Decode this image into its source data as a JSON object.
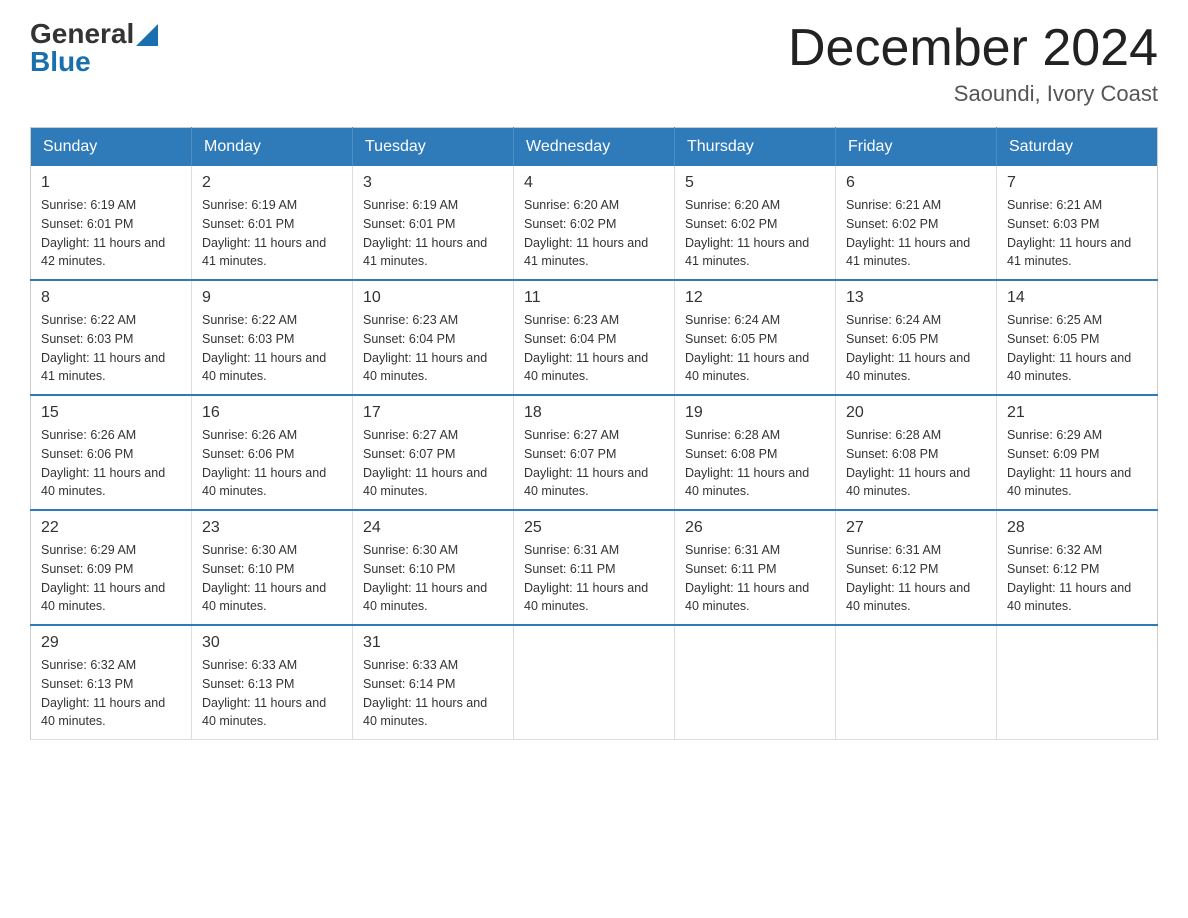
{
  "logo": {
    "general": "General",
    "blue": "Blue",
    "triangle": "▲"
  },
  "title": {
    "month_year": "December 2024",
    "location": "Saoundi, Ivory Coast"
  },
  "headers": [
    "Sunday",
    "Monday",
    "Tuesday",
    "Wednesday",
    "Thursday",
    "Friday",
    "Saturday"
  ],
  "weeks": [
    [
      {
        "day": "1",
        "sunrise": "Sunrise: 6:19 AM",
        "sunset": "Sunset: 6:01 PM",
        "daylight": "Daylight: 11 hours and 42 minutes."
      },
      {
        "day": "2",
        "sunrise": "Sunrise: 6:19 AM",
        "sunset": "Sunset: 6:01 PM",
        "daylight": "Daylight: 11 hours and 41 minutes."
      },
      {
        "day": "3",
        "sunrise": "Sunrise: 6:19 AM",
        "sunset": "Sunset: 6:01 PM",
        "daylight": "Daylight: 11 hours and 41 minutes."
      },
      {
        "day": "4",
        "sunrise": "Sunrise: 6:20 AM",
        "sunset": "Sunset: 6:02 PM",
        "daylight": "Daylight: 11 hours and 41 minutes."
      },
      {
        "day": "5",
        "sunrise": "Sunrise: 6:20 AM",
        "sunset": "Sunset: 6:02 PM",
        "daylight": "Daylight: 11 hours and 41 minutes."
      },
      {
        "day": "6",
        "sunrise": "Sunrise: 6:21 AM",
        "sunset": "Sunset: 6:02 PM",
        "daylight": "Daylight: 11 hours and 41 minutes."
      },
      {
        "day": "7",
        "sunrise": "Sunrise: 6:21 AM",
        "sunset": "Sunset: 6:03 PM",
        "daylight": "Daylight: 11 hours and 41 minutes."
      }
    ],
    [
      {
        "day": "8",
        "sunrise": "Sunrise: 6:22 AM",
        "sunset": "Sunset: 6:03 PM",
        "daylight": "Daylight: 11 hours and 41 minutes."
      },
      {
        "day": "9",
        "sunrise": "Sunrise: 6:22 AM",
        "sunset": "Sunset: 6:03 PM",
        "daylight": "Daylight: 11 hours and 40 minutes."
      },
      {
        "day": "10",
        "sunrise": "Sunrise: 6:23 AM",
        "sunset": "Sunset: 6:04 PM",
        "daylight": "Daylight: 11 hours and 40 minutes."
      },
      {
        "day": "11",
        "sunrise": "Sunrise: 6:23 AM",
        "sunset": "Sunset: 6:04 PM",
        "daylight": "Daylight: 11 hours and 40 minutes."
      },
      {
        "day": "12",
        "sunrise": "Sunrise: 6:24 AM",
        "sunset": "Sunset: 6:05 PM",
        "daylight": "Daylight: 11 hours and 40 minutes."
      },
      {
        "day": "13",
        "sunrise": "Sunrise: 6:24 AM",
        "sunset": "Sunset: 6:05 PM",
        "daylight": "Daylight: 11 hours and 40 minutes."
      },
      {
        "day": "14",
        "sunrise": "Sunrise: 6:25 AM",
        "sunset": "Sunset: 6:05 PM",
        "daylight": "Daylight: 11 hours and 40 minutes."
      }
    ],
    [
      {
        "day": "15",
        "sunrise": "Sunrise: 6:26 AM",
        "sunset": "Sunset: 6:06 PM",
        "daylight": "Daylight: 11 hours and 40 minutes."
      },
      {
        "day": "16",
        "sunrise": "Sunrise: 6:26 AM",
        "sunset": "Sunset: 6:06 PM",
        "daylight": "Daylight: 11 hours and 40 minutes."
      },
      {
        "day": "17",
        "sunrise": "Sunrise: 6:27 AM",
        "sunset": "Sunset: 6:07 PM",
        "daylight": "Daylight: 11 hours and 40 minutes."
      },
      {
        "day": "18",
        "sunrise": "Sunrise: 6:27 AM",
        "sunset": "Sunset: 6:07 PM",
        "daylight": "Daylight: 11 hours and 40 minutes."
      },
      {
        "day": "19",
        "sunrise": "Sunrise: 6:28 AM",
        "sunset": "Sunset: 6:08 PM",
        "daylight": "Daylight: 11 hours and 40 minutes."
      },
      {
        "day": "20",
        "sunrise": "Sunrise: 6:28 AM",
        "sunset": "Sunset: 6:08 PM",
        "daylight": "Daylight: 11 hours and 40 minutes."
      },
      {
        "day": "21",
        "sunrise": "Sunrise: 6:29 AM",
        "sunset": "Sunset: 6:09 PM",
        "daylight": "Daylight: 11 hours and 40 minutes."
      }
    ],
    [
      {
        "day": "22",
        "sunrise": "Sunrise: 6:29 AM",
        "sunset": "Sunset: 6:09 PM",
        "daylight": "Daylight: 11 hours and 40 minutes."
      },
      {
        "day": "23",
        "sunrise": "Sunrise: 6:30 AM",
        "sunset": "Sunset: 6:10 PM",
        "daylight": "Daylight: 11 hours and 40 minutes."
      },
      {
        "day": "24",
        "sunrise": "Sunrise: 6:30 AM",
        "sunset": "Sunset: 6:10 PM",
        "daylight": "Daylight: 11 hours and 40 minutes."
      },
      {
        "day": "25",
        "sunrise": "Sunrise: 6:31 AM",
        "sunset": "Sunset: 6:11 PM",
        "daylight": "Daylight: 11 hours and 40 minutes."
      },
      {
        "day": "26",
        "sunrise": "Sunrise: 6:31 AM",
        "sunset": "Sunset: 6:11 PM",
        "daylight": "Daylight: 11 hours and 40 minutes."
      },
      {
        "day": "27",
        "sunrise": "Sunrise: 6:31 AM",
        "sunset": "Sunset: 6:12 PM",
        "daylight": "Daylight: 11 hours and 40 minutes."
      },
      {
        "day": "28",
        "sunrise": "Sunrise: 6:32 AM",
        "sunset": "Sunset: 6:12 PM",
        "daylight": "Daylight: 11 hours and 40 minutes."
      }
    ],
    [
      {
        "day": "29",
        "sunrise": "Sunrise: 6:32 AM",
        "sunset": "Sunset: 6:13 PM",
        "daylight": "Daylight: 11 hours and 40 minutes."
      },
      {
        "day": "30",
        "sunrise": "Sunrise: 6:33 AM",
        "sunset": "Sunset: 6:13 PM",
        "daylight": "Daylight: 11 hours and 40 minutes."
      },
      {
        "day": "31",
        "sunrise": "Sunrise: 6:33 AM",
        "sunset": "Sunset: 6:14 PM",
        "daylight": "Daylight: 11 hours and 40 minutes."
      },
      null,
      null,
      null,
      null
    ]
  ]
}
